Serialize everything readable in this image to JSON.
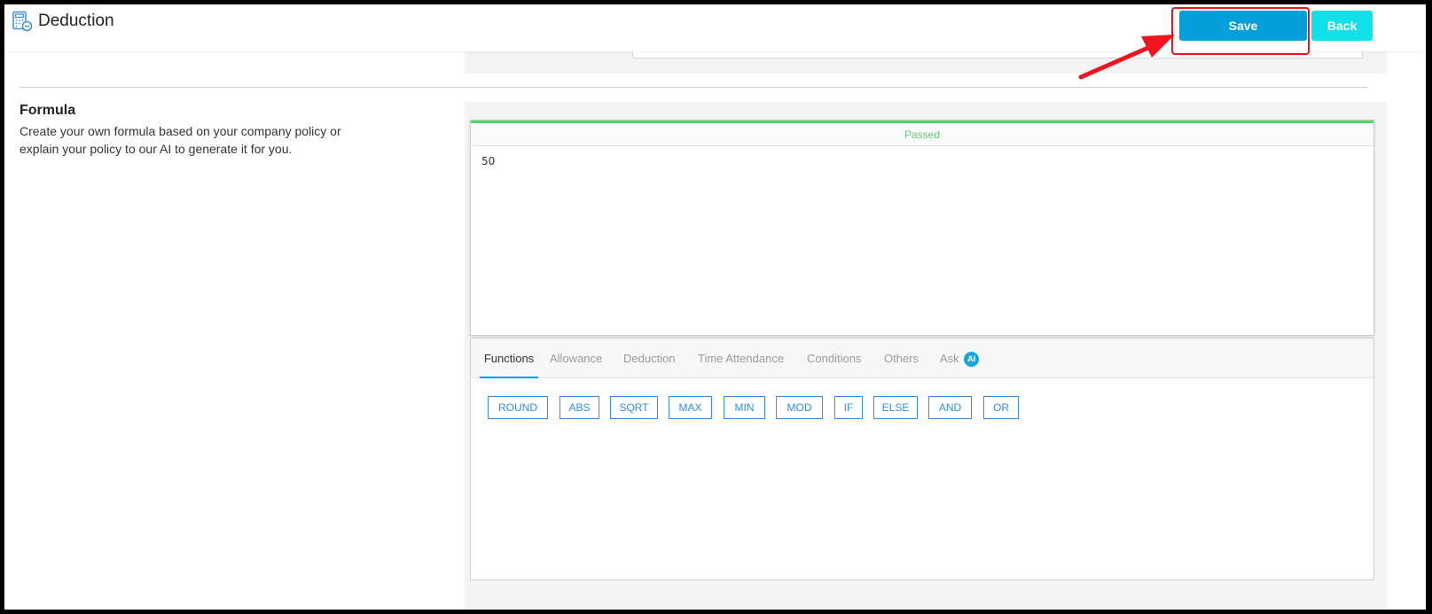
{
  "header": {
    "title": "Deduction",
    "save_label": "Save",
    "back_label": "Back"
  },
  "formula_section": {
    "title": "Formula",
    "description_line1": "Create your own formula based on your company policy or",
    "description_line2": "explain your policy to our AI to generate it for you."
  },
  "editor": {
    "status": "Passed",
    "content": "50"
  },
  "tabs": [
    {
      "label": "Functions"
    },
    {
      "label": "Allowance"
    },
    {
      "label": "Deduction"
    },
    {
      "label": "Time Attendance"
    },
    {
      "label": "Conditions"
    },
    {
      "label": "Others"
    },
    {
      "label": "Ask",
      "badge": "AI"
    }
  ],
  "functions": [
    "ROUND",
    "ABS",
    "SQRT",
    "MAX",
    "MIN",
    "MOD",
    "IF",
    "ELSE",
    "AND",
    "OR"
  ],
  "colors": {
    "save": "#069fde",
    "back": "#10e0e8",
    "passed": "#5fcf6f",
    "function_border": "#2f8fe6",
    "highlight": "#f0141e"
  }
}
